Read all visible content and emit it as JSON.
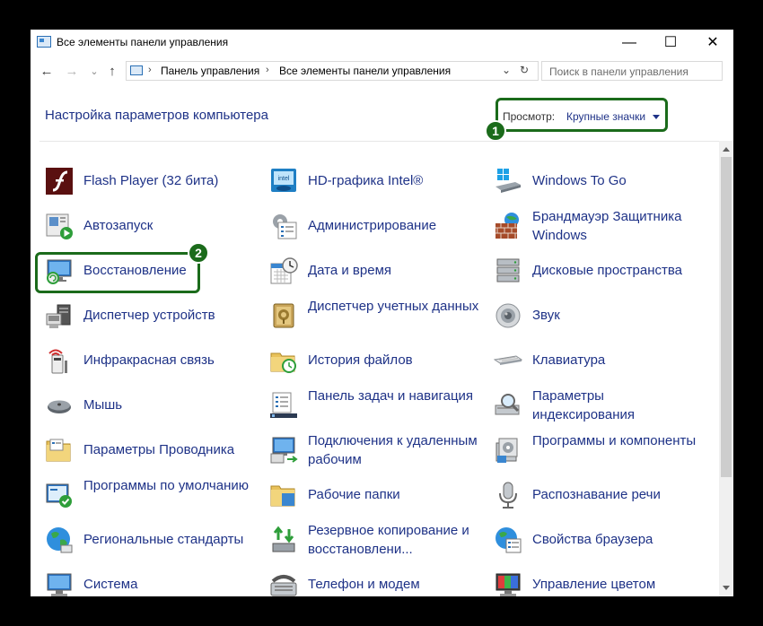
{
  "window": {
    "title": "Все элементы панели управления",
    "buttons": {
      "minimize": "—",
      "maximize": "☐",
      "close": "✕"
    }
  },
  "address": {
    "nav": {
      "back": "←",
      "forward": "→",
      "recent": "⌄",
      "up": "↑"
    },
    "sep": "›",
    "crumbs": [
      "Панель управления",
      "Все элементы панели управления"
    ],
    "dropdown": "⌄",
    "refresh": "↻",
    "search_placeholder": "Поиск в панели управления"
  },
  "header": {
    "heading": "Настройка параметров компьютера",
    "view_label": "Просмотр:",
    "view_value": "Крупные значки"
  },
  "annotations": {
    "badge1": "1",
    "badge2": "2"
  },
  "items": [
    {
      "label": "Flash Player (32 бита)",
      "icon": "flash-player-icon"
    },
    {
      "label": "HD-графика Intel®",
      "icon": "intel-graphics-icon"
    },
    {
      "label": "Windows To Go",
      "icon": "windows-to-go-icon"
    },
    {
      "label": "Автозапуск",
      "icon": "autoplay-icon"
    },
    {
      "label": "Администрирование",
      "icon": "administration-icon"
    },
    {
      "label": "Брандмауэр Защитника Windows",
      "icon": "firewall-icon"
    },
    {
      "label": "Восстановление",
      "icon": "recovery-icon"
    },
    {
      "label": "Дата и время",
      "icon": "date-time-icon"
    },
    {
      "label": "Дисковые пространства",
      "icon": "storage-spaces-icon"
    },
    {
      "label": "Диспетчер устройств",
      "icon": "device-manager-icon"
    },
    {
      "label": "Диспетчер учетных данных",
      "icon": "credential-manager-icon"
    },
    {
      "label": "Звук",
      "icon": "sound-icon"
    },
    {
      "label": "Инфракрасная связь",
      "icon": "infrared-icon"
    },
    {
      "label": "История файлов",
      "icon": "file-history-icon"
    },
    {
      "label": "Клавиатура",
      "icon": "keyboard-icon"
    },
    {
      "label": "Мышь",
      "icon": "mouse-icon"
    },
    {
      "label": "Панель задач и навигация",
      "icon": "taskbar-icon"
    },
    {
      "label": "Параметры индексирования",
      "icon": "indexing-icon"
    },
    {
      "label": "Параметры Проводника",
      "icon": "explorer-options-icon"
    },
    {
      "label": "Подключения к удаленным рабочим",
      "icon": "remote-desktop-icon"
    },
    {
      "label": "Программы и компоненты",
      "icon": "programs-features-icon"
    },
    {
      "label": "Программы по умолчанию",
      "icon": "default-programs-icon"
    },
    {
      "label": "Рабочие папки",
      "icon": "work-folders-icon"
    },
    {
      "label": "Распознавание речи",
      "icon": "speech-recognition-icon"
    },
    {
      "label": "Региональные стандарты",
      "icon": "region-icon"
    },
    {
      "label": "Резервное копирование и восстановлени...",
      "icon": "backup-restore-icon"
    },
    {
      "label": "Свойства браузера",
      "icon": "internet-options-icon"
    },
    {
      "label": "Система",
      "icon": "system-icon"
    },
    {
      "label": "Телефон и модем",
      "icon": "phone-modem-icon"
    },
    {
      "label": "Управление цветом",
      "icon": "color-management-icon"
    }
  ]
}
